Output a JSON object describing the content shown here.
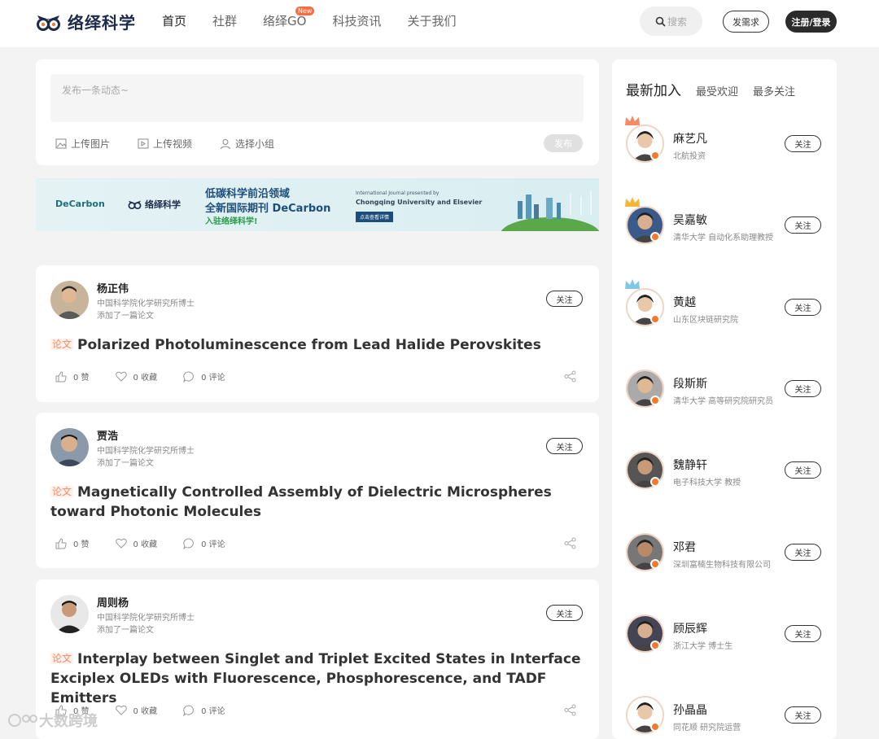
{
  "header": {
    "logo_text": "络绎科学",
    "nav": [
      {
        "label": "首页",
        "active": true
      },
      {
        "label": "社群",
        "active": false
      },
      {
        "label": "络绎GO",
        "badge": "New",
        "active": false
      },
      {
        "label": "科技资讯",
        "active": false
      },
      {
        "label": "关于我们",
        "active": false
      }
    ],
    "search_placeholder": "搜索",
    "demand_button": "发需求",
    "login_button": "注册/登录"
  },
  "composer": {
    "placeholder": "发布一条动态~",
    "tools": [
      "上传图片",
      "上传视频",
      "选择小组"
    ],
    "publish": "发布"
  },
  "banner": {
    "logo1": "DeCarbon",
    "logo2": "络绎科学",
    "line1": "低碳科学前沿领域",
    "line2": "全新国际期刊 DeCarbon",
    "line3": "入驻络绎科学!",
    "sub1": "International Journal presented by",
    "sub2": "Chongqing University and Elsevier",
    "button": "点击查看详情"
  },
  "feed": [
    {
      "name": "杨正伟",
      "affiliation": "中国科学院化学研究所博士",
      "action": "添加了一篇论文",
      "follow": "关注",
      "tag": "论文",
      "title": "Polarized Photoluminescence from Lead Halide Perovskites",
      "likes": "0 赞",
      "favs": "0 收藏",
      "comments": "0 评论"
    },
    {
      "name": "贾浩",
      "affiliation": "中国科学院化学研究所博士",
      "action": "添加了一篇论文",
      "follow": "关注",
      "tag": "论文",
      "title": "Magnetically Controlled Assembly of Dielectric Microspheres toward Photonic Molecules",
      "likes": "0 赞",
      "favs": "0 收藏",
      "comments": "0 评论"
    },
    {
      "name": "周则杨",
      "affiliation": "中国科学院化学研究所博士",
      "action": "添加了一篇论文",
      "follow": "关注",
      "tag": "论文",
      "title": "Interplay between Singlet and Triplet Excited States in Interface Exciplex OLEDs with Fluorescence, Phosphorescence, and TADF Emitters",
      "likes": "0 赞",
      "favs": "0 收藏",
      "comments": "0 评论"
    }
  ],
  "sidebar": {
    "tabs": [
      "最新加入",
      "最受欢迎",
      "最多关注"
    ],
    "users": [
      {
        "name": "麻艺凡",
        "desc": "北航投资",
        "follow": "关注",
        "crown": "#f28b66"
      },
      {
        "name": "吴嘉敏",
        "desc": "清华大学 自动化系助理教授",
        "follow": "关注",
        "crown": "#f5b733"
      },
      {
        "name": "黄越",
        "desc": "山东区块链研究院",
        "follow": "关注",
        "crown": "#7ec8e6"
      },
      {
        "name": "段斯斯",
        "desc": "清华大学 高等研究院研究员",
        "follow": "关注"
      },
      {
        "name": "魏静轩",
        "desc": "电子科技大学 教授",
        "follow": "关注"
      },
      {
        "name": "邓君",
        "desc": "深圳富楠生物科技有限公司",
        "follow": "关注"
      },
      {
        "name": "顾辰辉",
        "desc": "浙江大学 博士生",
        "follow": "关注"
      },
      {
        "name": "孙晶晶",
        "desc": "同花顺 研究院运营",
        "follow": "关注"
      }
    ]
  },
  "watermark": "大数跨境"
}
